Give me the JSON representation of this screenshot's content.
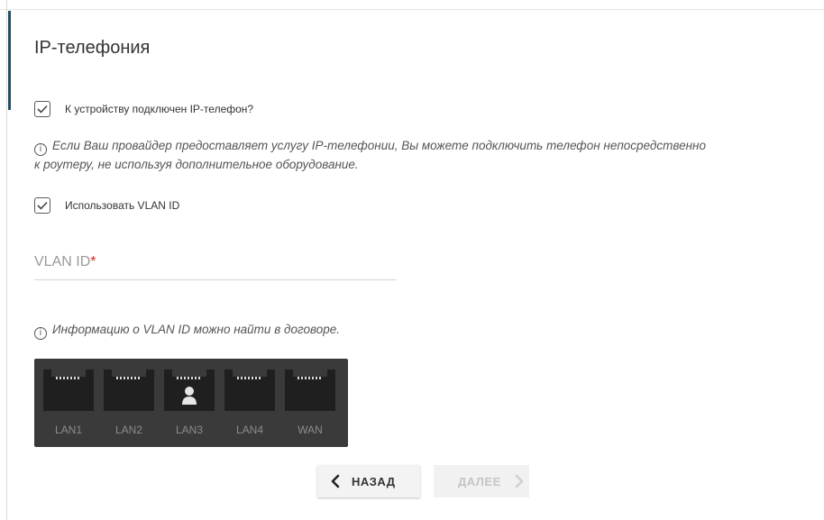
{
  "page": {
    "title": "IP-телефония"
  },
  "phone_connected": {
    "label": "К устройству подключен IP-телефон?",
    "checked": true
  },
  "info_provider": {
    "line1": "Если Ваш провайдер предоставляет услугу IP-телефонии, Вы можете подключить телефон непосредственно",
    "line2": "к роутеру, не используя дополнительное оборудование."
  },
  "use_vlan": {
    "label": "Использовать VLAN ID",
    "checked": true
  },
  "vlan_field": {
    "label": "VLAN ID",
    "required_mark": "*",
    "value": ""
  },
  "info_vlan": {
    "text": "Информацию о VLAN ID можно найти в договоре."
  },
  "ports": [
    {
      "label": "LAN1",
      "active": false
    },
    {
      "label": "LAN2",
      "active": false
    },
    {
      "label": "LAN3",
      "active": true
    },
    {
      "label": "LAN4",
      "active": false
    },
    {
      "label": "WAN",
      "active": false
    }
  ],
  "buttons": {
    "back": "НАЗАД",
    "next": "ДАЛЕЕ"
  },
  "colors": {
    "accent": "#1f4f62",
    "required": "#e0261b",
    "port_panel": "#3a3a3a"
  }
}
